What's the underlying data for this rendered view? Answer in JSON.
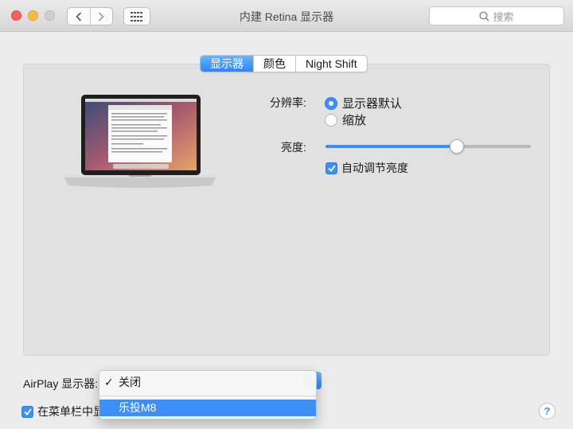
{
  "window": {
    "title": "内建 Retina 显示器"
  },
  "search": {
    "placeholder": "搜索"
  },
  "tabs": [
    {
      "label": "显示器",
      "active": true
    },
    {
      "label": "颜色",
      "active": false
    },
    {
      "label": "Night Shift",
      "active": false
    }
  ],
  "resolution": {
    "label": "分辨率:",
    "options": [
      {
        "label": "显示器默认",
        "selected": true
      },
      {
        "label": "缩放",
        "selected": false
      }
    ]
  },
  "brightness": {
    "label": "亮度:",
    "level": 0.64,
    "auto_adjust_label": "自动调节亮度",
    "auto_adjust_checked": true
  },
  "airplay": {
    "label": "AirPlay 显示器:",
    "menu": [
      {
        "label": "关闭",
        "checked": true
      },
      {
        "label": "乐投M8",
        "highlighted": true
      }
    ]
  },
  "menubar_option": {
    "label": "在菜单栏中显",
    "checked": true
  },
  "help": {
    "label": "?"
  },
  "colors": {
    "accent": "#3d8ff6",
    "panel": "#e1e1e1"
  }
}
